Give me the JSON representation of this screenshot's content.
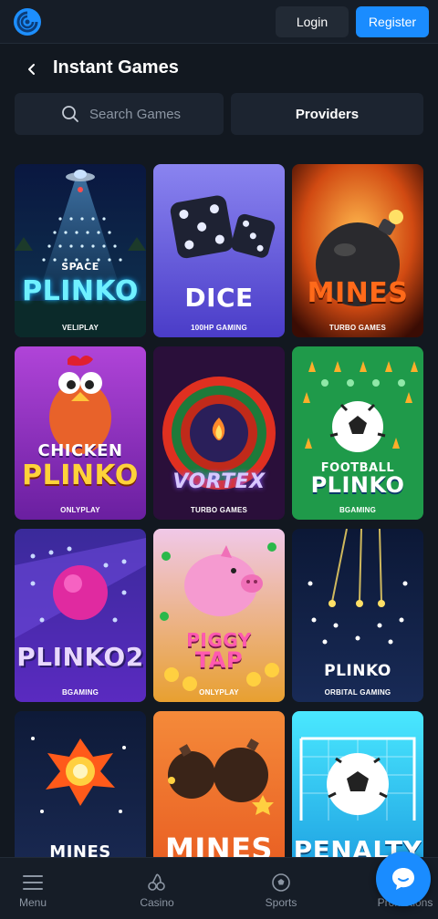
{
  "header": {
    "logo_icon": "swirl-logo-icon",
    "login_label": "Login",
    "register_label": "Register",
    "accent_color": "#1a8cff"
  },
  "page": {
    "title": "Instant Games",
    "back_icon": "chevron-left-icon"
  },
  "search": {
    "placeholder": "Search Games",
    "icon": "search-icon"
  },
  "providers_label": "Providers",
  "games": [
    {
      "title": "SPACE PLINKO",
      "display": "PLINKO",
      "provider": "VELIPLAY"
    },
    {
      "title": "DICE",
      "display": "DICE",
      "provider": "100HP GAMING"
    },
    {
      "title": "MINES",
      "display": "MINES",
      "provider": "TURBO GAMES"
    },
    {
      "title": "CHICKEN PLINKO",
      "display": "PLINKO",
      "provider": "ONLYPLAY"
    },
    {
      "title": "VORTEX",
      "display": "VORTEX",
      "provider": "TURBO GAMES"
    },
    {
      "title": "FOOTBALL PLINKO",
      "display": "PLINKO",
      "provider": "BGAMING"
    },
    {
      "title": "PLINKO 2",
      "display": "PLINKO2",
      "provider": "BGAMING"
    },
    {
      "title": "PIGGY TAP",
      "display": "TAP",
      "provider": "ONLYPLAY"
    },
    {
      "title": "PLINKO",
      "display": "PLINKO",
      "provider": "ORBITAL GAMING"
    },
    {
      "title": "MINES",
      "display": "MINES",
      "provider": ""
    },
    {
      "title": "MINES",
      "display": "MINES",
      "provider": ""
    },
    {
      "title": "PENALTY",
      "display": "PENALTY",
      "provider": ""
    }
  ],
  "game_subtitles": {
    "space": "SPACE",
    "chicken": "CHICKEN",
    "football": "FOOTBALL",
    "piggy": "PIGGY"
  },
  "bottom_nav": [
    {
      "label": "Menu",
      "icon": "hamburger-menu-icon"
    },
    {
      "label": "Casino",
      "icon": "cherries-icon"
    },
    {
      "label": "Sports",
      "icon": "soccer-ball-icon"
    },
    {
      "label": "Promotions",
      "icon": "gift-icon"
    }
  ],
  "chat_icon": "chat-bubble-icon"
}
